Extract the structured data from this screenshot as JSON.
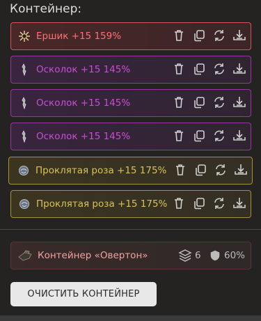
{
  "title": "Контейнер:",
  "items": [
    {
      "name": "Ершик +15 159%",
      "theme": "red"
    },
    {
      "name": "Осколок +15 145%",
      "theme": "purple"
    },
    {
      "name": "Осколок +15 145%",
      "theme": "purple"
    },
    {
      "name": "Осколок +15 145%",
      "theme": "purple"
    },
    {
      "name": "Проклятая роза +15 175%",
      "theme": "gold"
    },
    {
      "name": "Проклятая роза +15 175%",
      "theme": "gold"
    }
  ],
  "action_icons": [
    "trash-icon",
    "copy-icon",
    "refresh-icon",
    "download-icon"
  ],
  "container": {
    "name": "Контейнер «Овертон»",
    "layers": "6",
    "defense": "60%"
  },
  "clear_button": "ОЧИСТИТЬ КОНТЕЙНЕР",
  "colors": {
    "red": "#d9545a",
    "purple": "#9a36a4",
    "gold": "#a89238",
    "background": "#242321"
  }
}
